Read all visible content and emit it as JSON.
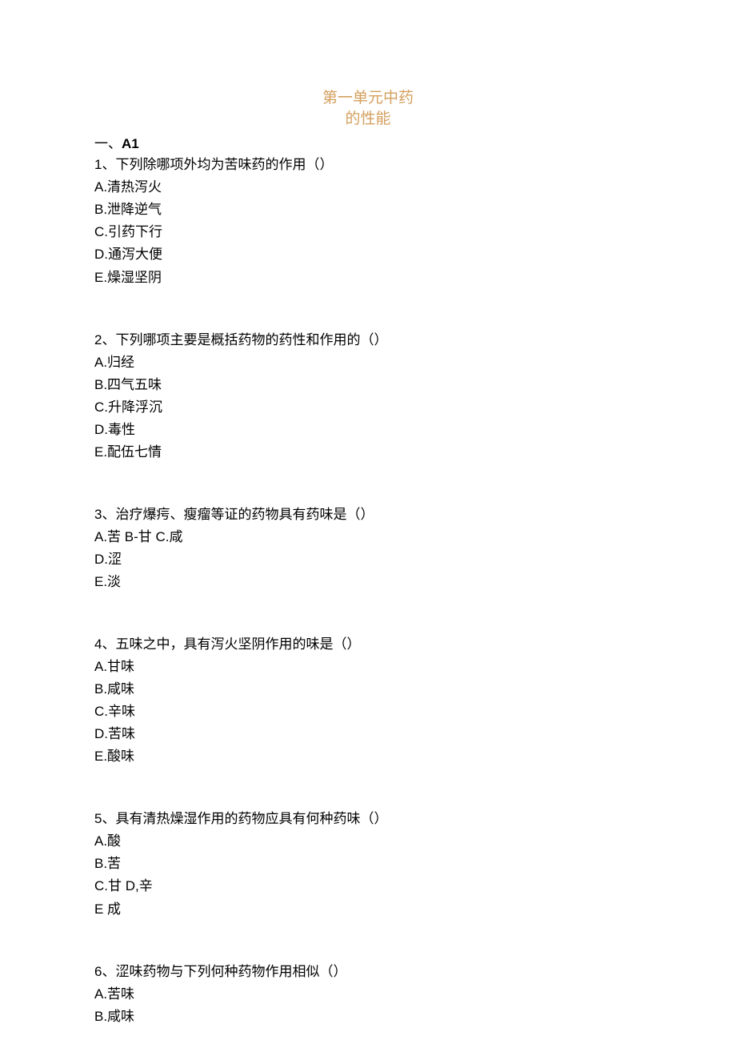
{
  "title_line1": "第一单元中药",
  "title_line2": "的性能",
  "section_label_prefix": "一、",
  "section_label_bold": "A1",
  "questions": [
    {
      "stem": "1、下列除哪项外均为苦味药的作用（）",
      "options": [
        "A.清热泻火",
        "B.泄降逆气",
        "C.引药下行",
        "D.通泻大便",
        "E.燥湿坚阴"
      ]
    },
    {
      "stem": "2、下列哪项主要是概括药物的药性和作用的（）",
      "options": [
        "A.归经",
        "B.四气五味",
        "C.升降浮沉",
        "D.毒性",
        "E.配伍七情"
      ]
    },
    {
      "stem": "3、治疗爆疞、瘦瘤等证的药物具有药味是（）",
      "options": [
        "A.苦 B-甘 C.咸",
        "D.涩",
        "E.淡"
      ]
    },
    {
      "stem": "4、五味之中，具有泻火坚阴作用的味是（）",
      "options": [
        "A.甘味",
        "B.咸味",
        "C.辛味",
        "D.苦味",
        "E.酸味"
      ]
    },
    {
      "stem": "5、具有清热燥湿作用的药物应具有何种药味（）",
      "options": [
        "A.酸",
        "B.苦",
        "C.甘 D,辛",
        "E 成"
      ]
    },
    {
      "stem": "6、涩味药物与下列何种药物作用相似（）",
      "options": [
        "A.苦味",
        "B.咸味"
      ]
    }
  ]
}
